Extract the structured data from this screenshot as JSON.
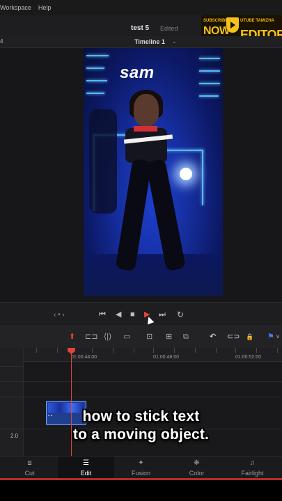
{
  "menubar": {
    "items": [
      "Workspace",
      "Help"
    ]
  },
  "project": {
    "title": "test 5",
    "status": "Edited"
  },
  "viewer": {
    "left_indicator": "4",
    "timeline_name": "Timeline 1",
    "overlay_text": "sam"
  },
  "badge": {
    "line1": "SUBSCRIBE",
    "line2": "NOW",
    "line3": "UTUBE TAMIZHA",
    "line4": "EDITOR"
  },
  "transport": {
    "nav": "‹ • ›",
    "first": "⏮",
    "prev": "◀",
    "stop": "■",
    "play": "▶",
    "last": "⏭",
    "loop": "↻"
  },
  "edit_tools": {
    "select": "⬆",
    "trim": "⊏⊐",
    "dynamic": "⟨|⟩",
    "blade": "▭",
    "insert": "⊡",
    "overwrite": "⊞",
    "replace": "⧉",
    "snap": "↶",
    "link": "⊂⊃",
    "lock": "🔒",
    "flag": "⚑",
    "flag_more": "∨"
  },
  "timeline": {
    "timecodes": [
      "01:00:44:00",
      "01:00:48:00",
      "01:00:52:00"
    ],
    "clip_label": "▪ ▪",
    "audio_track": "2.0"
  },
  "caption": {
    "line1": "how to stick text",
    "line2": "to a moving object."
  },
  "pages": {
    "tabs": [
      {
        "label": "Cut",
        "icon": "⧈"
      },
      {
        "label": "Edit",
        "icon": "☰"
      },
      {
        "label": "Fusion",
        "icon": "✦"
      },
      {
        "label": "Color",
        "icon": "❋"
      },
      {
        "label": "Fairlight",
        "icon": "♫"
      }
    ]
  },
  "colors": {
    "accent_red": "#e0443a",
    "badge_gold": "#f5c21b",
    "video_blue": "#1d3fd0"
  }
}
